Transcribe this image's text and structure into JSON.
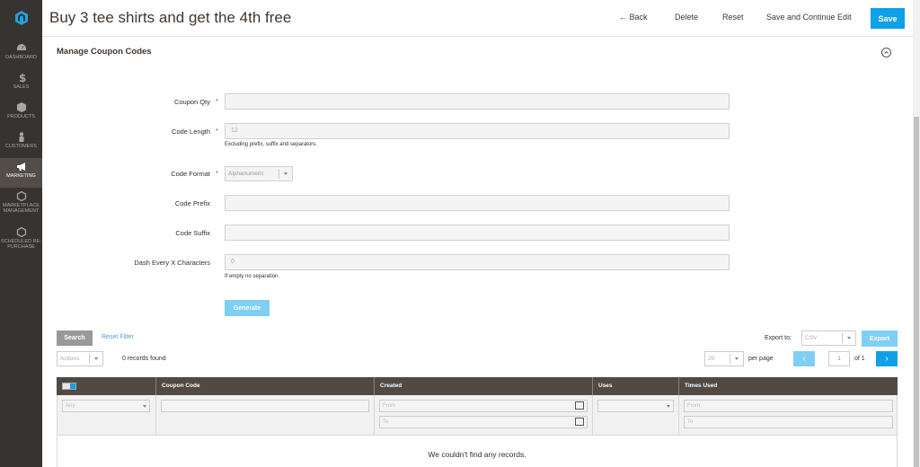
{
  "sidebar": {
    "items": [
      {
        "label": "DASHBOARD",
        "icon": "dashboard-icon"
      },
      {
        "label": "SALES",
        "icon": "dollar-icon"
      },
      {
        "label": "PRODUCTS",
        "icon": "box-icon"
      },
      {
        "label": "CUSTOMERS",
        "icon": "person-icon"
      },
      {
        "label": "MARKETING",
        "icon": "megaphone-icon"
      },
      {
        "label": "MARKETPLACE MANAGEMENT",
        "icon": "hexagon-icon"
      },
      {
        "label": "SCHEDULED RE-PURCHASE",
        "icon": "hexagon-icon"
      }
    ]
  },
  "header": {
    "title": "Buy 3 tee shirts and get the 4th free",
    "back": "Back",
    "delete": "Delete",
    "reset": "Reset",
    "save_continue": "Save and Continue Edit",
    "save": "Save"
  },
  "section": {
    "title": "Manage Coupon Codes"
  },
  "form": {
    "coupon_qty": {
      "label": "Coupon Qty",
      "value": ""
    },
    "code_length": {
      "label": "Code Length",
      "value": "12",
      "note": "Excluding prefix, suffix and separators."
    },
    "code_format": {
      "label": "Code Format",
      "value": "Alphanumeric"
    },
    "code_prefix": {
      "label": "Code Prefix",
      "value": ""
    },
    "code_suffix": {
      "label": "Code Suffix",
      "value": ""
    },
    "dash_every": {
      "label": "Dash Every X Characters",
      "value": "0",
      "note": "If empty no separation."
    },
    "generate": "Generate"
  },
  "grid": {
    "search": "Search",
    "reset_filter": "Reset Filter",
    "export_to": "Export to:",
    "export_format": "CSV",
    "export": "Export",
    "actions": "Actions",
    "records_found": "0 records found",
    "per_page_value": "20",
    "per_page": "per page",
    "page": "1",
    "of_pages": "of 1",
    "columns": [
      "",
      "Coupon Code",
      "Created",
      "Uses",
      "Times Used"
    ],
    "filters": {
      "any": "Any",
      "created_from": "From",
      "created_to": "To",
      "times_from": "From",
      "times_to": "To"
    },
    "empty": "We couldn't find any records."
  },
  "colors": {
    "primary": "#0ea0e8",
    "sidebar": "#373330",
    "table_header": "#514943"
  }
}
